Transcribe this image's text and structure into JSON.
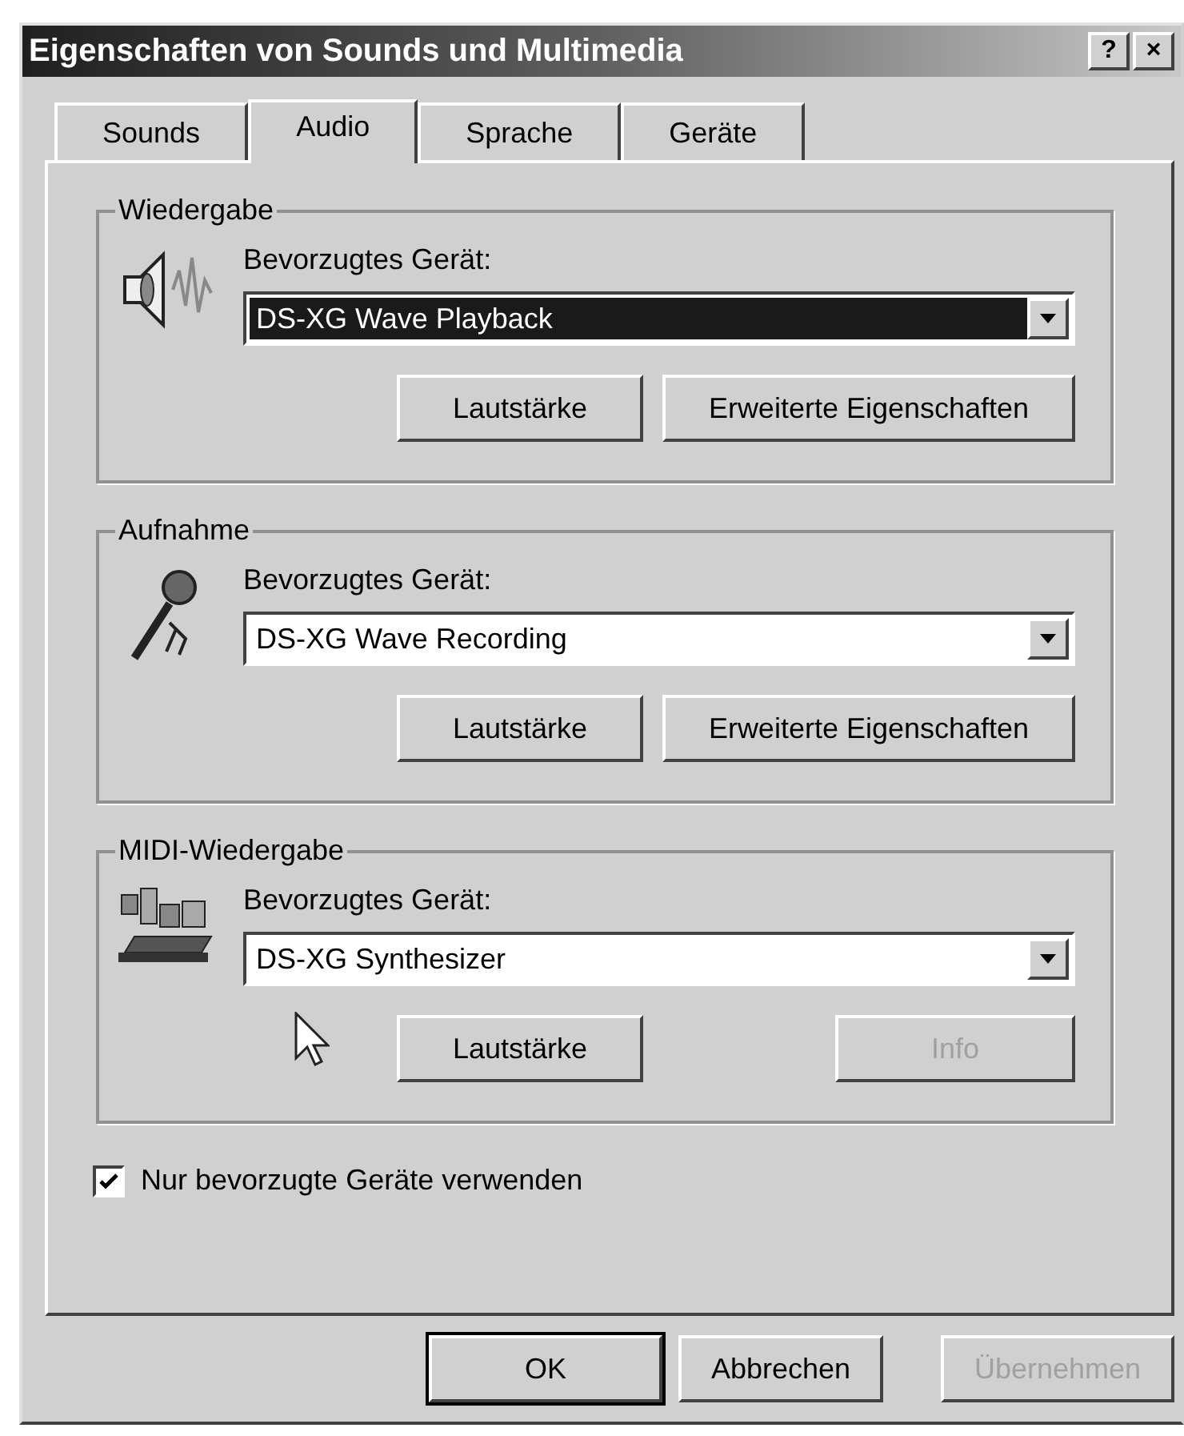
{
  "window": {
    "title": "Eigenschaften von Sounds und Multimedia",
    "buttons": [
      "?",
      "×"
    ]
  },
  "tabs": [
    {
      "label": "Sounds",
      "selected": false
    },
    {
      "label": "Audio",
      "selected": true
    },
    {
      "label": "Sprache",
      "selected": false
    },
    {
      "label": "Geräte",
      "selected": false
    }
  ],
  "groups": [
    {
      "title": "Wiedergabe",
      "kind": "speaker",
      "device_label": "Bevorzugtes Gerät:",
      "device": "DS-XG Wave Playback",
      "focused": true,
      "buttons": [
        {
          "label": "Lautstärke",
          "disabled": false
        },
        {
          "label": "Erweiterte Eigenschaften",
          "disabled": false
        }
      ]
    },
    {
      "title": "Aufnahme",
      "kind": "microphone",
      "device_label": "Bevorzugtes Gerät:",
      "device": "DS-XG Wave Recording",
      "focused": false,
      "buttons": [
        {
          "label": "Lautstärke",
          "disabled": false
        },
        {
          "label": "Erweiterte Eigenschaften",
          "disabled": false
        }
      ]
    },
    {
      "title": "MIDI-Wiedergabe",
      "kind": "midi",
      "device_label": "Bevorzugtes Gerät:",
      "device": "DS-XG Synthesizer",
      "focused": false,
      "buttons": [
        {
          "label": "Lautstärke",
          "disabled": false
        },
        {
          "label": "Info",
          "disabled": true
        }
      ]
    }
  ],
  "checkbox": {
    "label": "Nur bevorzugte Geräte verwenden",
    "checked": true
  },
  "footer_buttons": [
    {
      "label": "OK",
      "disabled": false,
      "default": true
    },
    {
      "label": "Abbrechen",
      "disabled": false,
      "default": false
    },
    {
      "label": "Übernehmen",
      "disabled": true,
      "default": false
    }
  ]
}
